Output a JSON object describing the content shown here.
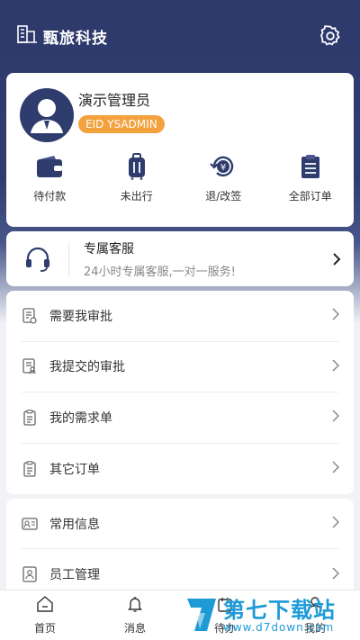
{
  "header": {
    "brand_name": "甄旅科技"
  },
  "profile": {
    "name": "演示管理员",
    "eid": "EID YSADMIN"
  },
  "orders": [
    {
      "label": "待付款",
      "icon": "wallet-icon"
    },
    {
      "label": "未出行",
      "icon": "luggage-icon"
    },
    {
      "label": "退/改签",
      "icon": "refund-icon"
    },
    {
      "label": "全部订单",
      "icon": "order-list-icon"
    }
  ],
  "service": {
    "title": "专属客服",
    "subtitle": "24小时专属客服,一对一服务!"
  },
  "menu1": [
    {
      "label": "需要我审批",
      "icon": "approval-pending-icon"
    },
    {
      "label": "我提交的审批",
      "icon": "approval-submitted-icon"
    },
    {
      "label": "我的需求单",
      "icon": "request-form-icon"
    },
    {
      "label": "其它订单",
      "icon": "other-orders-icon"
    }
  ],
  "menu2": [
    {
      "label": "常用信息",
      "icon": "id-card-icon"
    },
    {
      "label": "员工管理",
      "icon": "employee-icon"
    }
  ],
  "tabs": [
    {
      "label": "首页",
      "icon": "home-icon"
    },
    {
      "label": "消息",
      "icon": "bell-icon"
    },
    {
      "label": "待办",
      "icon": "todo-icon"
    },
    {
      "label": "我的",
      "icon": "user-icon"
    }
  ],
  "watermark": {
    "main": "第七下载站",
    "sub": "www.d7down.com"
  },
  "colors": {
    "header": "#2f3c6e",
    "badge": "#f3a23e",
    "icon": "#2f3c6e",
    "watermark": "#1e9bd7"
  }
}
